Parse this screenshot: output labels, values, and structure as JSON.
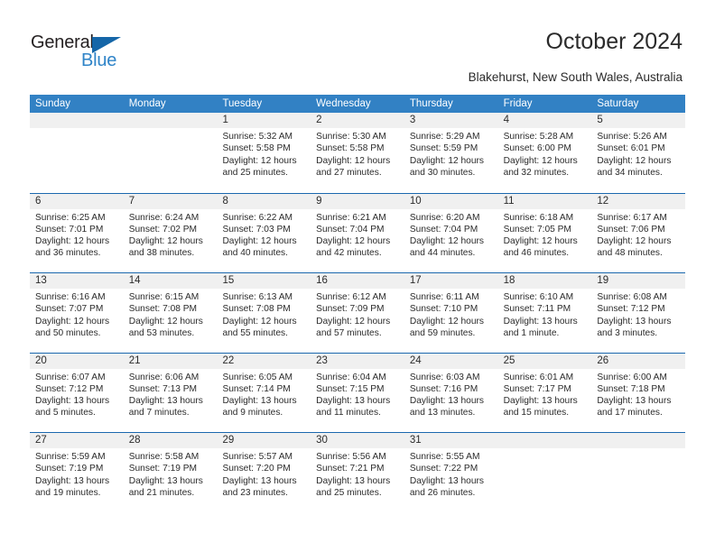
{
  "brand": {
    "name_part1": "General",
    "name_part2": "Blue",
    "triangle_color": "#1566a8",
    "blue_color": "#2f84c8"
  },
  "header": {
    "title": "October 2024",
    "subtitle": "Blakehurst, New South Wales, Australia"
  },
  "theme": {
    "header_bar_color": "#3281c4",
    "week_divider_color": "#1b68ae",
    "day_band_color": "#f0f0f0",
    "text_color": "#2b2b2b"
  },
  "weekdays": [
    "Sunday",
    "Monday",
    "Tuesday",
    "Wednesday",
    "Thursday",
    "Friday",
    "Saturday"
  ],
  "weeks": [
    [
      {
        "day": "",
        "sunrise": "",
        "sunset": "",
        "daylight_1": "",
        "daylight_2": ""
      },
      {
        "day": "",
        "sunrise": "",
        "sunset": "",
        "daylight_1": "",
        "daylight_2": ""
      },
      {
        "day": "1",
        "sunrise": "Sunrise: 5:32 AM",
        "sunset": "Sunset: 5:58 PM",
        "daylight_1": "Daylight: 12 hours",
        "daylight_2": "and 25 minutes."
      },
      {
        "day": "2",
        "sunrise": "Sunrise: 5:30 AM",
        "sunset": "Sunset: 5:58 PM",
        "daylight_1": "Daylight: 12 hours",
        "daylight_2": "and 27 minutes."
      },
      {
        "day": "3",
        "sunrise": "Sunrise: 5:29 AM",
        "sunset": "Sunset: 5:59 PM",
        "daylight_1": "Daylight: 12 hours",
        "daylight_2": "and 30 minutes."
      },
      {
        "day": "4",
        "sunrise": "Sunrise: 5:28 AM",
        "sunset": "Sunset: 6:00 PM",
        "daylight_1": "Daylight: 12 hours",
        "daylight_2": "and 32 minutes."
      },
      {
        "day": "5",
        "sunrise": "Sunrise: 5:26 AM",
        "sunset": "Sunset: 6:01 PM",
        "daylight_1": "Daylight: 12 hours",
        "daylight_2": "and 34 minutes."
      }
    ],
    [
      {
        "day": "6",
        "sunrise": "Sunrise: 6:25 AM",
        "sunset": "Sunset: 7:01 PM",
        "daylight_1": "Daylight: 12 hours",
        "daylight_2": "and 36 minutes."
      },
      {
        "day": "7",
        "sunrise": "Sunrise: 6:24 AM",
        "sunset": "Sunset: 7:02 PM",
        "daylight_1": "Daylight: 12 hours",
        "daylight_2": "and 38 minutes."
      },
      {
        "day": "8",
        "sunrise": "Sunrise: 6:22 AM",
        "sunset": "Sunset: 7:03 PM",
        "daylight_1": "Daylight: 12 hours",
        "daylight_2": "and 40 minutes."
      },
      {
        "day": "9",
        "sunrise": "Sunrise: 6:21 AM",
        "sunset": "Sunset: 7:04 PM",
        "daylight_1": "Daylight: 12 hours",
        "daylight_2": "and 42 minutes."
      },
      {
        "day": "10",
        "sunrise": "Sunrise: 6:20 AM",
        "sunset": "Sunset: 7:04 PM",
        "daylight_1": "Daylight: 12 hours",
        "daylight_2": "and 44 minutes."
      },
      {
        "day": "11",
        "sunrise": "Sunrise: 6:18 AM",
        "sunset": "Sunset: 7:05 PM",
        "daylight_1": "Daylight: 12 hours",
        "daylight_2": "and 46 minutes."
      },
      {
        "day": "12",
        "sunrise": "Sunrise: 6:17 AM",
        "sunset": "Sunset: 7:06 PM",
        "daylight_1": "Daylight: 12 hours",
        "daylight_2": "and 48 minutes."
      }
    ],
    [
      {
        "day": "13",
        "sunrise": "Sunrise: 6:16 AM",
        "sunset": "Sunset: 7:07 PM",
        "daylight_1": "Daylight: 12 hours",
        "daylight_2": "and 50 minutes."
      },
      {
        "day": "14",
        "sunrise": "Sunrise: 6:15 AM",
        "sunset": "Sunset: 7:08 PM",
        "daylight_1": "Daylight: 12 hours",
        "daylight_2": "and 53 minutes."
      },
      {
        "day": "15",
        "sunrise": "Sunrise: 6:13 AM",
        "sunset": "Sunset: 7:08 PM",
        "daylight_1": "Daylight: 12 hours",
        "daylight_2": "and 55 minutes."
      },
      {
        "day": "16",
        "sunrise": "Sunrise: 6:12 AM",
        "sunset": "Sunset: 7:09 PM",
        "daylight_1": "Daylight: 12 hours",
        "daylight_2": "and 57 minutes."
      },
      {
        "day": "17",
        "sunrise": "Sunrise: 6:11 AM",
        "sunset": "Sunset: 7:10 PM",
        "daylight_1": "Daylight: 12 hours",
        "daylight_2": "and 59 minutes."
      },
      {
        "day": "18",
        "sunrise": "Sunrise: 6:10 AM",
        "sunset": "Sunset: 7:11 PM",
        "daylight_1": "Daylight: 13 hours",
        "daylight_2": "and 1 minute."
      },
      {
        "day": "19",
        "sunrise": "Sunrise: 6:08 AM",
        "sunset": "Sunset: 7:12 PM",
        "daylight_1": "Daylight: 13 hours",
        "daylight_2": "and 3 minutes."
      }
    ],
    [
      {
        "day": "20",
        "sunrise": "Sunrise: 6:07 AM",
        "sunset": "Sunset: 7:12 PM",
        "daylight_1": "Daylight: 13 hours",
        "daylight_2": "and 5 minutes."
      },
      {
        "day": "21",
        "sunrise": "Sunrise: 6:06 AM",
        "sunset": "Sunset: 7:13 PM",
        "daylight_1": "Daylight: 13 hours",
        "daylight_2": "and 7 minutes."
      },
      {
        "day": "22",
        "sunrise": "Sunrise: 6:05 AM",
        "sunset": "Sunset: 7:14 PM",
        "daylight_1": "Daylight: 13 hours",
        "daylight_2": "and 9 minutes."
      },
      {
        "day": "23",
        "sunrise": "Sunrise: 6:04 AM",
        "sunset": "Sunset: 7:15 PM",
        "daylight_1": "Daylight: 13 hours",
        "daylight_2": "and 11 minutes."
      },
      {
        "day": "24",
        "sunrise": "Sunrise: 6:03 AM",
        "sunset": "Sunset: 7:16 PM",
        "daylight_1": "Daylight: 13 hours",
        "daylight_2": "and 13 minutes."
      },
      {
        "day": "25",
        "sunrise": "Sunrise: 6:01 AM",
        "sunset": "Sunset: 7:17 PM",
        "daylight_1": "Daylight: 13 hours",
        "daylight_2": "and 15 minutes."
      },
      {
        "day": "26",
        "sunrise": "Sunrise: 6:00 AM",
        "sunset": "Sunset: 7:18 PM",
        "daylight_1": "Daylight: 13 hours",
        "daylight_2": "and 17 minutes."
      }
    ],
    [
      {
        "day": "27",
        "sunrise": "Sunrise: 5:59 AM",
        "sunset": "Sunset: 7:19 PM",
        "daylight_1": "Daylight: 13 hours",
        "daylight_2": "and 19 minutes."
      },
      {
        "day": "28",
        "sunrise": "Sunrise: 5:58 AM",
        "sunset": "Sunset: 7:19 PM",
        "daylight_1": "Daylight: 13 hours",
        "daylight_2": "and 21 minutes."
      },
      {
        "day": "29",
        "sunrise": "Sunrise: 5:57 AM",
        "sunset": "Sunset: 7:20 PM",
        "daylight_1": "Daylight: 13 hours",
        "daylight_2": "and 23 minutes."
      },
      {
        "day": "30",
        "sunrise": "Sunrise: 5:56 AM",
        "sunset": "Sunset: 7:21 PM",
        "daylight_1": "Daylight: 13 hours",
        "daylight_2": "and 25 minutes."
      },
      {
        "day": "31",
        "sunrise": "Sunrise: 5:55 AM",
        "sunset": "Sunset: 7:22 PM",
        "daylight_1": "Daylight: 13 hours",
        "daylight_2": "and 26 minutes."
      },
      {
        "day": "",
        "sunrise": "",
        "sunset": "",
        "daylight_1": "",
        "daylight_2": ""
      },
      {
        "day": "",
        "sunrise": "",
        "sunset": "",
        "daylight_1": "",
        "daylight_2": ""
      }
    ]
  ]
}
